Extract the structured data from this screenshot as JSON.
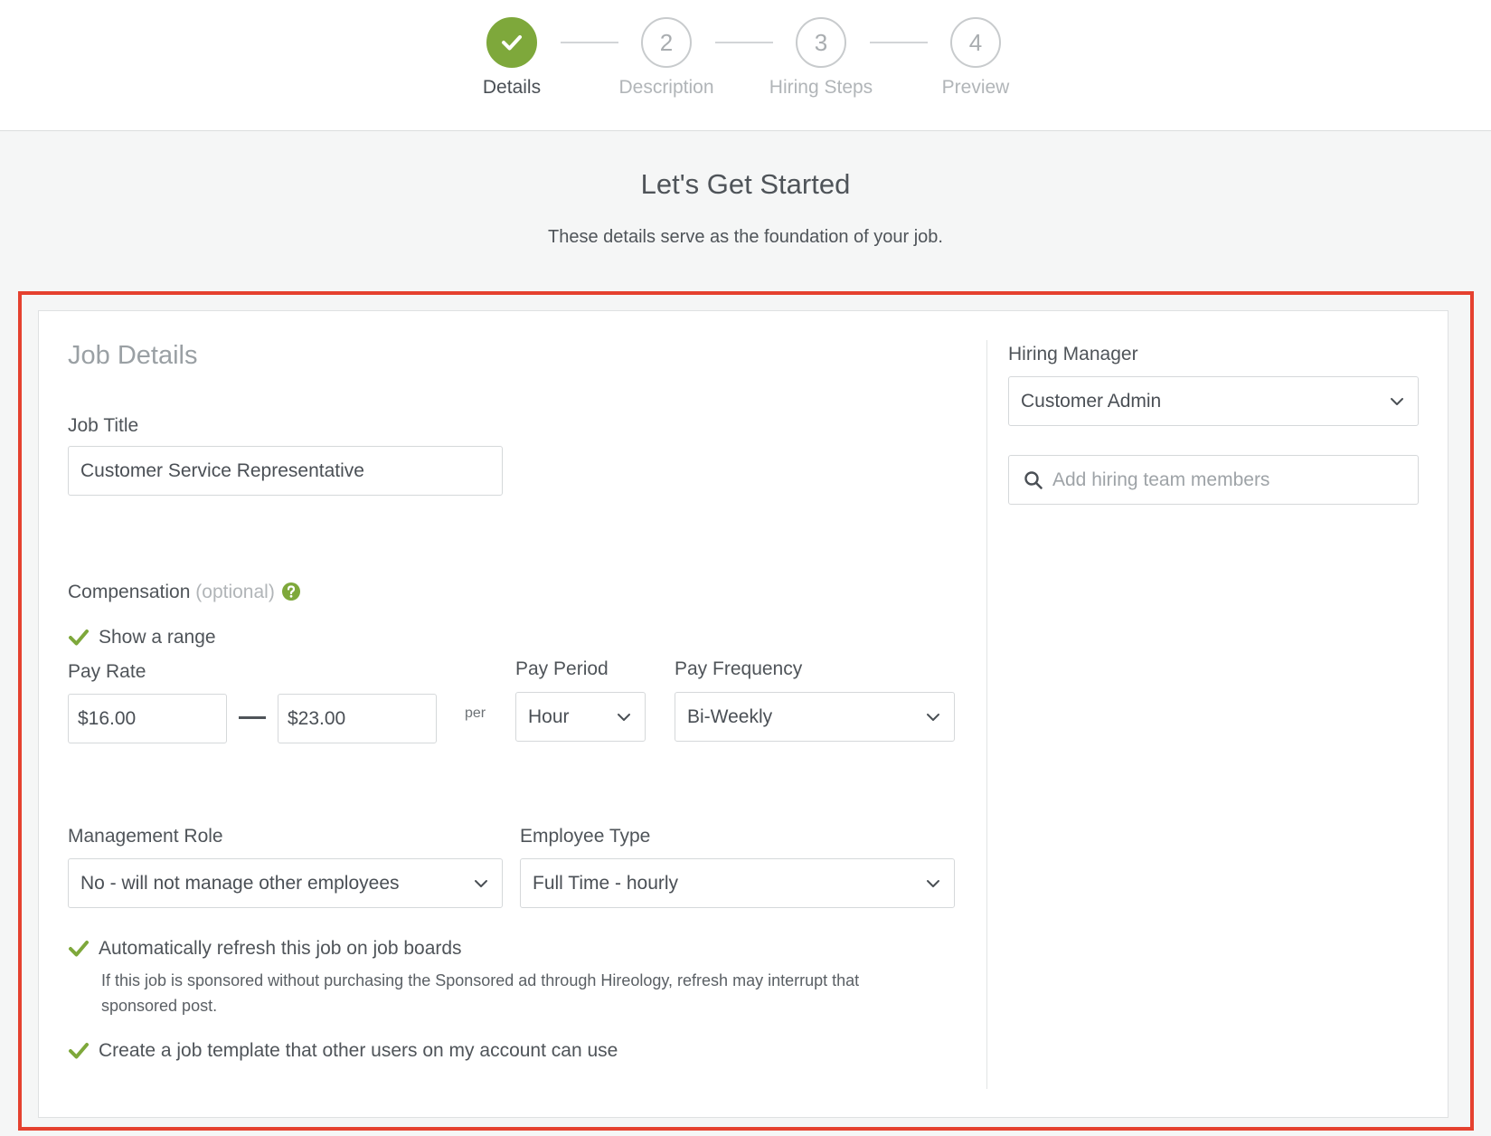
{
  "stepper": {
    "steps": [
      {
        "number": "",
        "label": "Details",
        "state": "complete",
        "icon": "checkmark-icon"
      },
      {
        "number": "2",
        "label": "Description",
        "state": "pending"
      },
      {
        "number": "3",
        "label": "Hiring Steps",
        "state": "pending"
      },
      {
        "number": "4",
        "label": "Preview",
        "state": "pending"
      }
    ]
  },
  "header": {
    "title": "Let's Get Started",
    "subtitle": "These details serve as the foundation of your job."
  },
  "job_details": {
    "section_title": "Job Details",
    "job_title_label": "Job Title",
    "job_title_value": "Customer Service Representative",
    "compensation_label": "Compensation",
    "compensation_optional": "(optional)",
    "show_range_label": "Show a range",
    "show_range_checked": true,
    "pay_rate_label": "Pay Rate",
    "pay_rate_min": "$16.00",
    "pay_rate_max": "$23.00",
    "per_label": "per",
    "pay_period_label": "Pay Period",
    "pay_period_value": "Hour",
    "pay_frequency_label": "Pay Frequency",
    "pay_frequency_value": "Bi-Weekly",
    "management_role_label": "Management Role",
    "management_role_value": "No - will not manage other employees",
    "employee_type_label": "Employee Type",
    "employee_type_value": "Full Time - hourly",
    "auto_refresh_label": "Automatically refresh this job on job boards",
    "auto_refresh_checked": true,
    "auto_refresh_help": "If this job is sponsored without purchasing the Sponsored ad through Hireology, refresh may interrupt that sponsored post.",
    "template_label": "Create a job template that other users on my account can use",
    "template_checked": true
  },
  "hiring": {
    "manager_label": "Hiring Manager",
    "manager_value": "Customer Admin",
    "team_placeholder": "Add hiring team members"
  },
  "colors": {
    "accent_green": "#7ea83b",
    "highlight_red": "#e5412f"
  }
}
